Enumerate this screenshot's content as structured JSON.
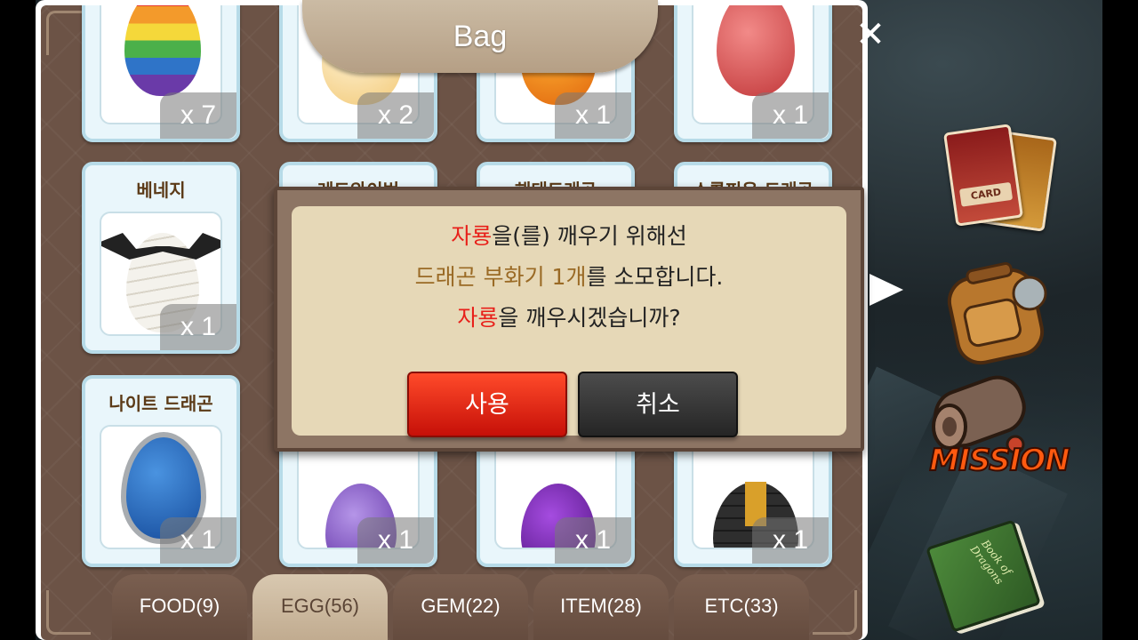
{
  "bag": {
    "title": "Bag",
    "close_label": "✕"
  },
  "items": [
    {
      "name": "",
      "qty": "x 7",
      "egg": "rainbow-egg"
    },
    {
      "name": "",
      "qty": "x 2",
      "egg": "cream-spotted-egg"
    },
    {
      "name": "",
      "qty": "x 1",
      "egg": "orange-egg"
    },
    {
      "name": "",
      "qty": "x 1",
      "egg": "red-horned-egg"
    },
    {
      "name": "베네지",
      "qty": "x 1",
      "egg": "bandaged-winged-egg"
    },
    {
      "name": "레드와이번",
      "qty": "",
      "egg": ""
    },
    {
      "name": "해태드래곤",
      "qty": "",
      "egg": ""
    },
    {
      "name": "스콜피온 드래곤",
      "qty": "",
      "egg": ""
    },
    {
      "name": "나이트 드래곤",
      "qty": "x 1",
      "egg": "blue-armored-egg"
    },
    {
      "name": "",
      "qty": "x 1",
      "egg": "purple-egg"
    },
    {
      "name": "",
      "qty": "x 1",
      "egg": "violet-spotted-egg"
    },
    {
      "name": "",
      "qty": "x 1",
      "egg": "black-gold-egg"
    }
  ],
  "tabs": [
    {
      "label": "FOOD(9)",
      "active": false
    },
    {
      "label": "EGG(56)",
      "active": true
    },
    {
      "label": "GEM(22)",
      "active": false
    },
    {
      "label": "ITEM(28)",
      "active": false
    },
    {
      "label": "ETC(33)",
      "active": false
    }
  ],
  "dialog": {
    "line1_highlight": "자룡",
    "line1_rest": "을(를) 깨우기 위해선",
    "line2_highlight": "드래곤 부화기 1개",
    "line2_rest": "를 소모합니다.",
    "line3_highlight": "자룡",
    "line3_rest": "을 깨우시겠습니까?",
    "confirm_label": "사용",
    "cancel_label": "취소"
  },
  "side_menu": {
    "card_label": "CARD",
    "mission_label": "MISSION",
    "book_label": "Book of Dragons"
  },
  "colors": {
    "highlight_red": "#e8201a",
    "highlight_brown": "#9a6a25",
    "confirm_button": "#e5261a",
    "cancel_button": "#353535",
    "panel_brown": "#6c5346"
  }
}
